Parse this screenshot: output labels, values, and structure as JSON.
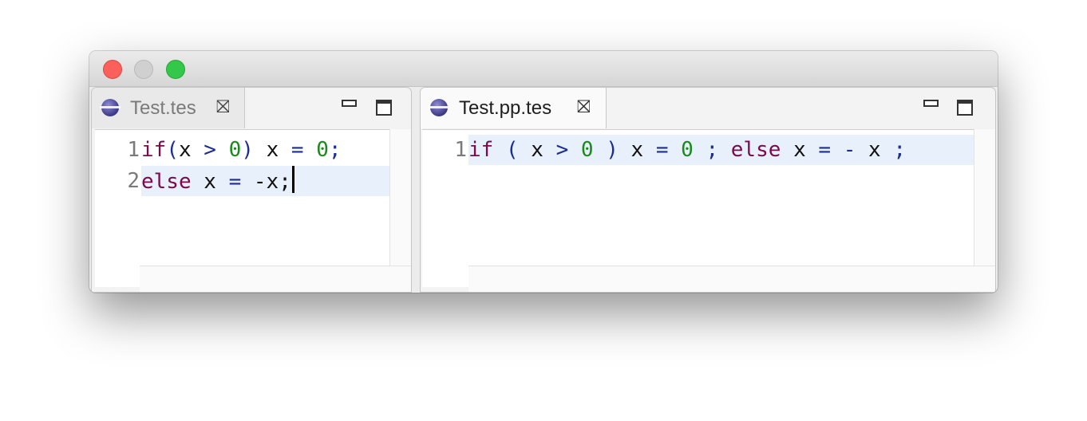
{
  "window": {
    "controls": {
      "close": "close",
      "minimize": "minimize",
      "maximize": "maximize"
    }
  },
  "editors": [
    {
      "tab_label": "Test.tes",
      "active": false,
      "lines": [
        {
          "number": "1",
          "tokens": [
            {
              "t": "if",
              "c": "kw"
            },
            {
              "t": "(",
              "c": "op"
            },
            {
              "t": "x",
              "c": "id"
            },
            {
              "t": " ",
              "c": "id"
            },
            {
              "t": ">",
              "c": "op"
            },
            {
              "t": " ",
              "c": "id"
            },
            {
              "t": "0",
              "c": "num"
            },
            {
              "t": ")",
              "c": "op"
            },
            {
              "t": " ",
              "c": "id"
            },
            {
              "t": "x",
              "c": "id"
            },
            {
              "t": " ",
              "c": "id"
            },
            {
              "t": "=",
              "c": "op"
            },
            {
              "t": " ",
              "c": "id"
            },
            {
              "t": "0",
              "c": "num"
            },
            {
              "t": ";",
              "c": "op"
            }
          ]
        },
        {
          "number": "2",
          "current": true,
          "caret": true,
          "tokens": [
            {
              "t": "else",
              "c": "kw"
            },
            {
              "t": " ",
              "c": "id"
            },
            {
              "t": "x",
              "c": "id"
            },
            {
              "t": " ",
              "c": "id"
            },
            {
              "t": "=",
              "c": "op"
            },
            {
              "t": " ",
              "c": "id"
            },
            {
              "t": "-x;",
              "c": "id"
            }
          ]
        }
      ]
    },
    {
      "tab_label": "Test.pp.tes",
      "active": true,
      "lines": [
        {
          "number": "1",
          "current": true,
          "tokens": [
            {
              "t": "if",
              "c": "kw"
            },
            {
              "t": " ",
              "c": "id"
            },
            {
              "t": "(",
              "c": "op"
            },
            {
              "t": " ",
              "c": "id"
            },
            {
              "t": "x",
              "c": "id"
            },
            {
              "t": " ",
              "c": "id"
            },
            {
              "t": ">",
              "c": "op"
            },
            {
              "t": " ",
              "c": "id"
            },
            {
              "t": "0",
              "c": "num"
            },
            {
              "t": " ",
              "c": "id"
            },
            {
              "t": ")",
              "c": "op"
            },
            {
              "t": " ",
              "c": "id"
            },
            {
              "t": "x",
              "c": "id"
            },
            {
              "t": " ",
              "c": "id"
            },
            {
              "t": "=",
              "c": "op"
            },
            {
              "t": " ",
              "c": "id"
            },
            {
              "t": "0",
              "c": "num"
            },
            {
              "t": " ",
              "c": "id"
            },
            {
              "t": ";",
              "c": "op"
            },
            {
              "t": " ",
              "c": "id"
            },
            {
              "t": "else",
              "c": "kw"
            },
            {
              "t": " ",
              "c": "id"
            },
            {
              "t": "x",
              "c": "id"
            },
            {
              "t": " ",
              "c": "id"
            },
            {
              "t": "=",
              "c": "op"
            },
            {
              "t": " ",
              "c": "id"
            },
            {
              "t": "-",
              "c": "op"
            },
            {
              "t": " ",
              "c": "id"
            },
            {
              "t": "x",
              "c": "id"
            },
            {
              "t": " ",
              "c": "id"
            },
            {
              "t": ";",
              "c": "op"
            }
          ]
        }
      ]
    }
  ],
  "icons": {
    "tab_icon": "eclipse-file-icon",
    "tab_close": "close-tab-icon",
    "minimize": "minimize-view-icon",
    "maximize": "maximize-view-icon"
  },
  "colors": {
    "keyword": "#7a0a4c",
    "number": "#1a8a1a",
    "operator": "#1c2e8f",
    "current_line": "#e7f0fb"
  }
}
